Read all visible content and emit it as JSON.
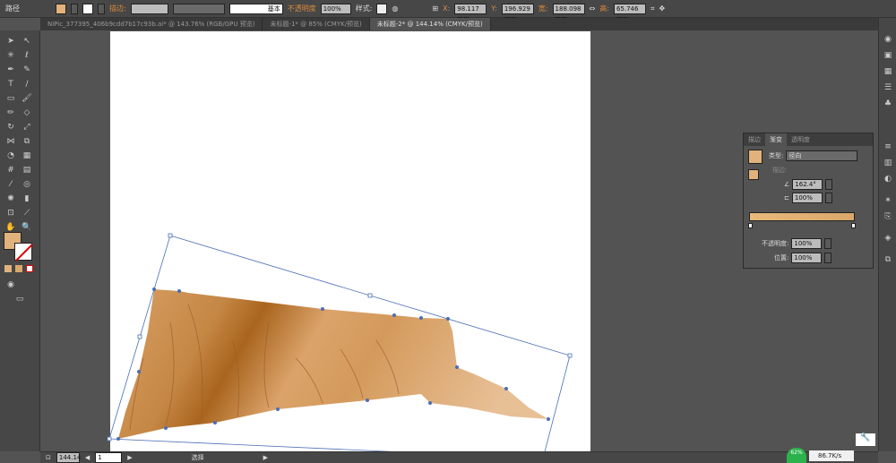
{
  "control_bar": {
    "object_type": "路径",
    "stroke_label": "描边:",
    "opacity_label": "不透明度",
    "opacity_value": "100%",
    "stroke_profile": "基本",
    "style_label": "样式:",
    "x_label": "X:",
    "x_value": "98.117 mm",
    "y_label": "Y:",
    "y_value": "196.929 mm",
    "w_label": "宽:",
    "w_value": "188.098 mm",
    "h_label": "高:",
    "h_value": "65.746 mm"
  },
  "tabs": [
    {
      "label": "NiPic_377395_406b9cdd7b17c93b.ai* @ 143.76% (RGB/GPU 预览)"
    },
    {
      "label": "未标题-1* @ 85% (CMYK/预览)"
    },
    {
      "label": "未标题-2* @ 144.14% (CMYK/预览)",
      "active": true
    }
  ],
  "gradient_panel": {
    "tabs": [
      "描边",
      "渐变",
      "透明度"
    ],
    "active_tab": "渐变",
    "type_label": "类型:",
    "type_value": "径向",
    "stroke_label": "描边:",
    "angle_value": "162.4°",
    "aspect_value": "100%",
    "opacity_label": "不透明度:",
    "opacity_value": "100%",
    "location_label": "位置:",
    "location_value": "100%",
    "start_color": "#e8b97a",
    "end_color": "#d9a86a"
  },
  "colors": {
    "fill": "#e2b27c",
    "shape_light": "#e8bd8a",
    "shape_dark": "#a9651f",
    "selection": "#4a6fb5"
  },
  "status_bar": {
    "zoom": "144.14",
    "page": "1",
    "tool": "选择"
  },
  "net_widget": {
    "percent": "62%",
    "speed": "86.7K/s"
  }
}
